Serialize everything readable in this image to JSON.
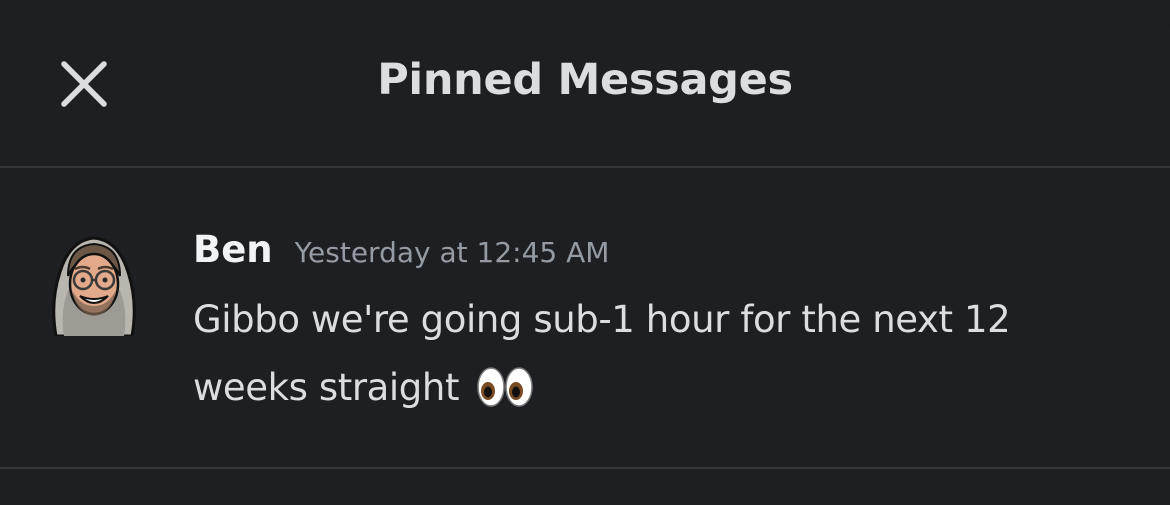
{
  "header": {
    "title": "Pinned Messages",
    "close_icon": "close-icon"
  },
  "pinned_messages": [
    {
      "author": "Ben",
      "timestamp": "Yesterday at 12:45 AM",
      "text": "Gibbo we're going sub-1 hour for the next 12 weeks straight",
      "emoji": "eyes-emoji",
      "avatar": "bitmoji-avatar"
    }
  ],
  "colors": {
    "background": "#1e1f22",
    "divider": "#35363c",
    "title": "#dbdee1",
    "author": "#f2f3f5",
    "timestamp": "#949ba4",
    "message_text": "#dbdee1"
  }
}
